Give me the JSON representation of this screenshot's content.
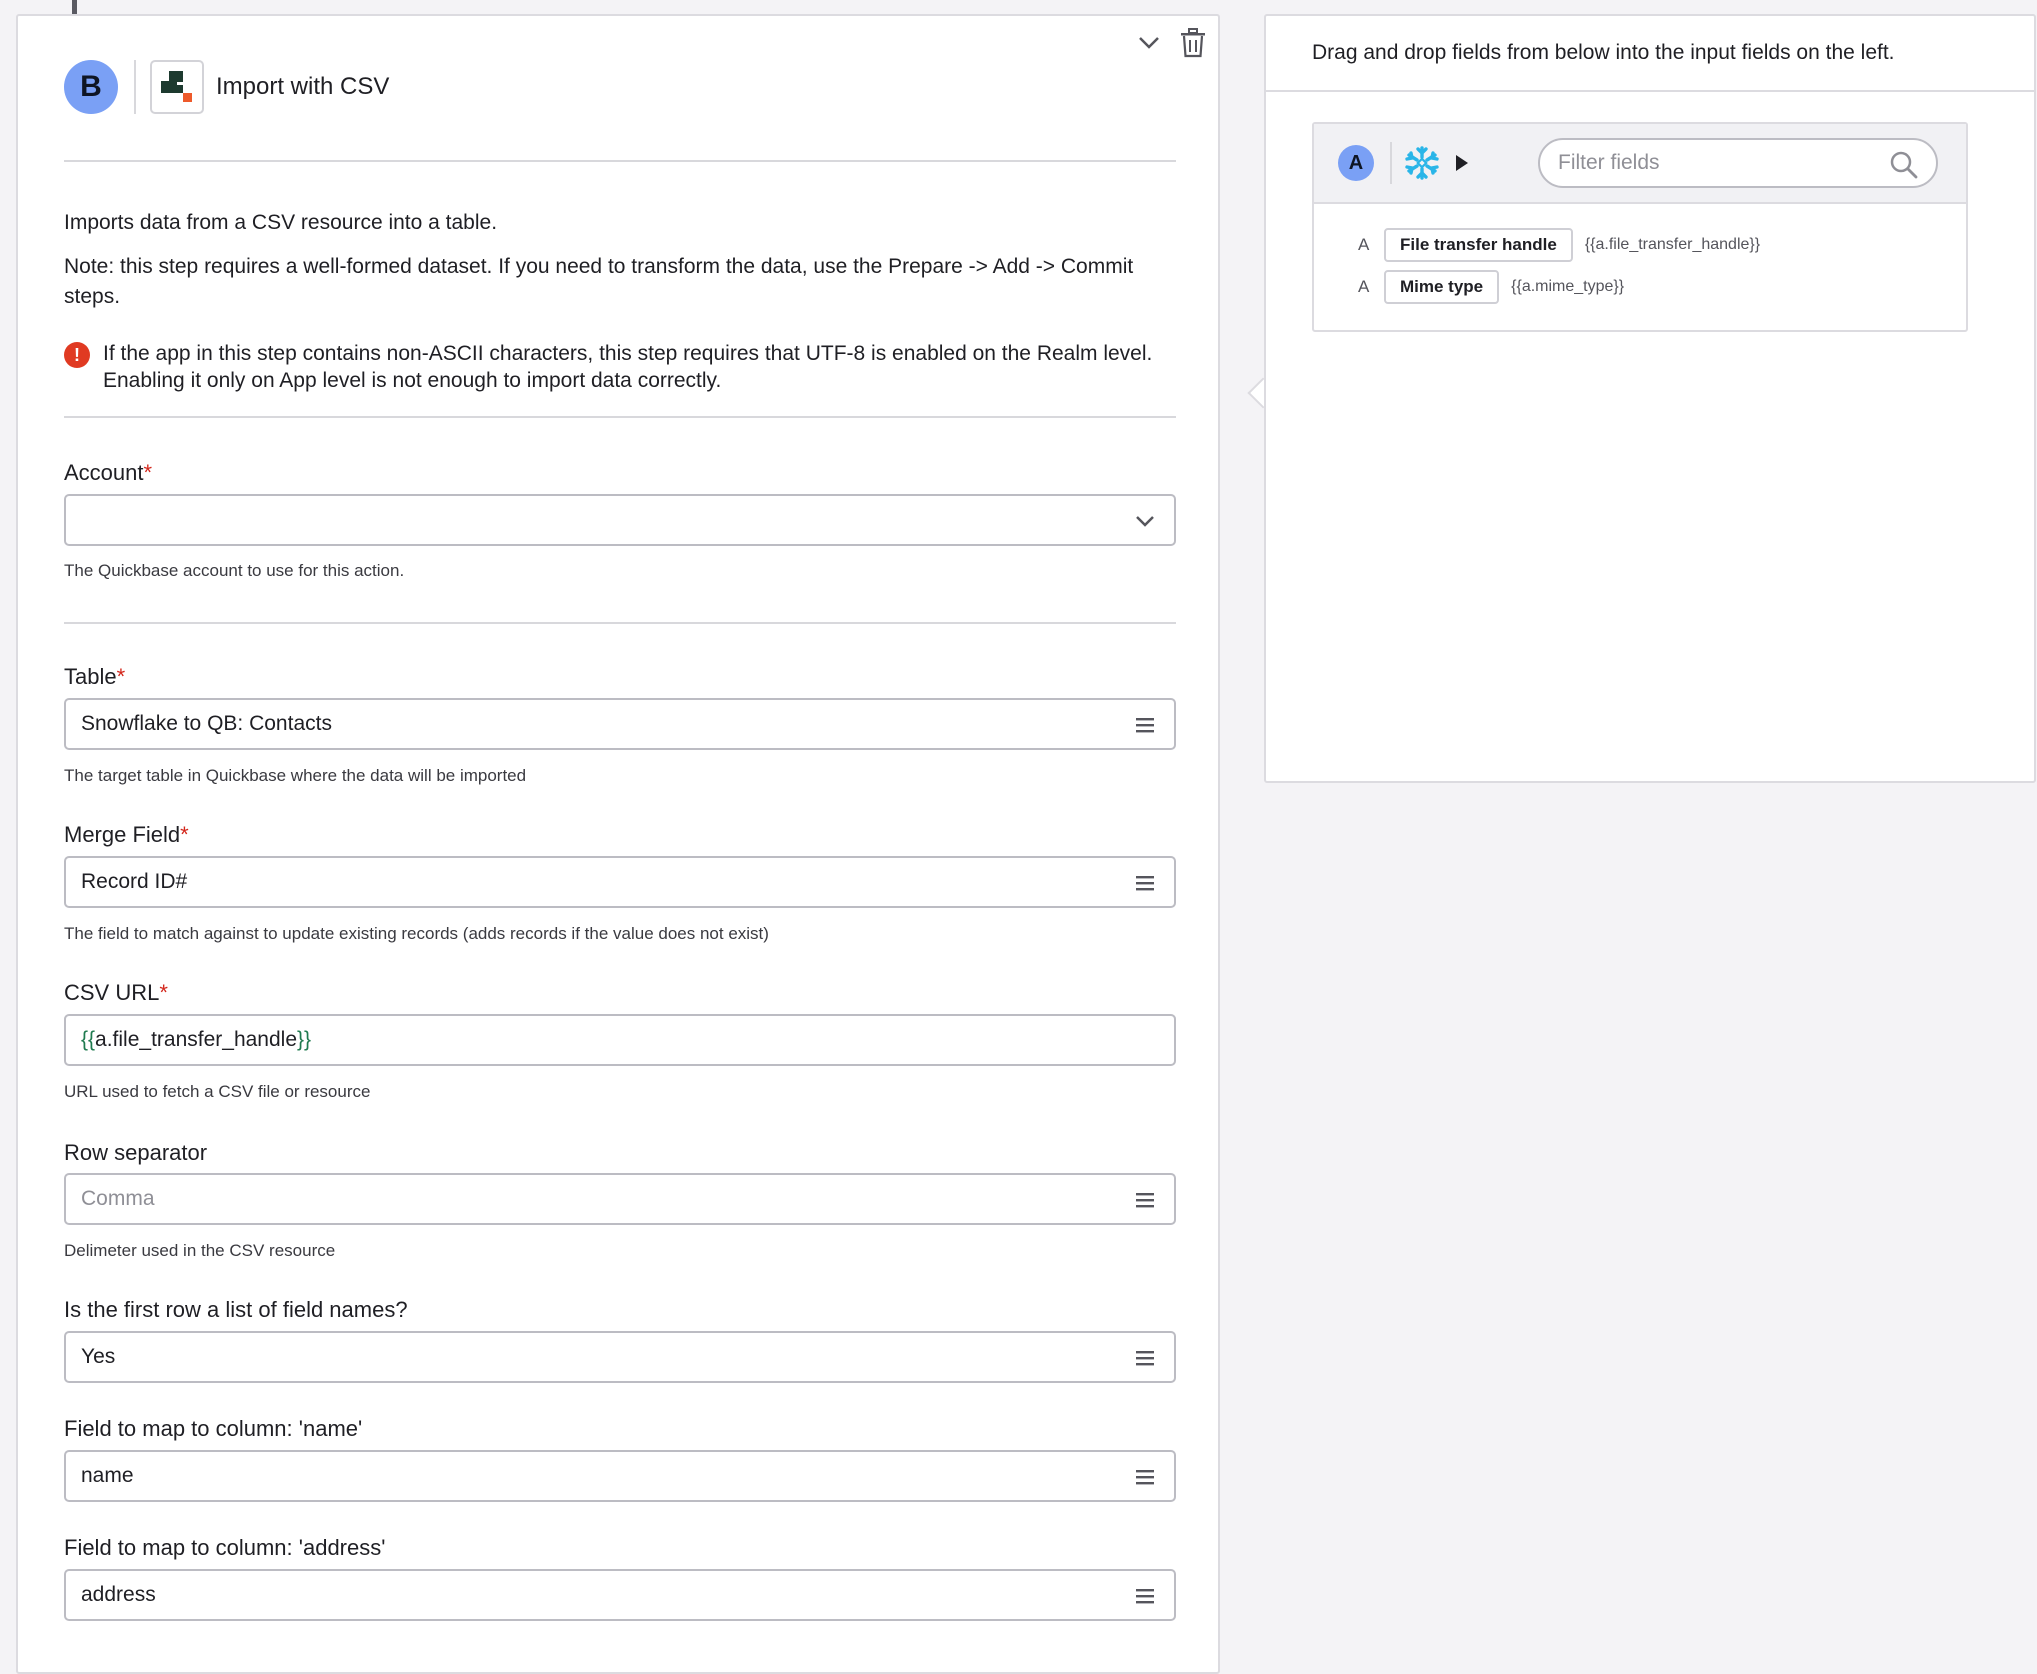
{
  "step": {
    "badge": "B",
    "title": "Import with CSV",
    "description": "Imports data from a CSV resource into a table.",
    "note": "Note: this step requires a well-formed dataset. If you need to transform the data, use the Prepare -> Add -> Commit steps.",
    "warning": "If the app in this step contains non-ASCII characters, this step requires that UTF-8 is enabled on the Realm level. Enabling it only on App level is not enough to import data correctly."
  },
  "fields": {
    "account": {
      "label": "Account",
      "required": "*",
      "value": "",
      "help": "The Quickbase account to use for this action."
    },
    "table": {
      "label": "Table",
      "required": "*",
      "value": "Snowflake to QB: Contacts",
      "help": "The target table in Quickbase where the data will be imported"
    },
    "merge": {
      "label": "Merge Field",
      "required": "*",
      "value": "Record ID#",
      "help": "The field to match against to update existing records (adds records if the value does not exist)"
    },
    "csv_url": {
      "label": "CSV URL",
      "required": "*",
      "open": "{{",
      "value": "a.file_transfer_handle",
      "close": "}}",
      "help": "URL used to fetch a CSV file or resource"
    },
    "row_sep": {
      "label": "Row separator",
      "placeholder": "Comma",
      "help": "Delimeter used in the CSV resource"
    },
    "first_row": {
      "label": "Is the first row a list of field names?",
      "value": "Yes"
    },
    "map_name": {
      "label": "Field to map to column: 'name'",
      "value": "name"
    },
    "map_address": {
      "label": "Field to map to column: 'address'",
      "value": "address"
    }
  },
  "panel": {
    "instruction": "Drag and drop fields from below into the input fields on the left.",
    "source_badge": "A",
    "filter_placeholder": "Filter fields",
    "items": [
      {
        "type": "A",
        "label": "File transfer handle",
        "token": "{{a.file_transfer_handle}}"
      },
      {
        "type": "A",
        "label": "Mime type",
        "token": "{{a.mime_type}}"
      }
    ]
  },
  "colors": {
    "accent_badge": "#7aa0f5",
    "required": "#d3261b",
    "warning": "#e03a22",
    "snowflake": "#29b5e8"
  },
  "icons": [
    "chevron-down-icon",
    "trash-icon",
    "menu-icon",
    "search-icon",
    "snowflake-icon",
    "play-icon",
    "alert-icon"
  ]
}
